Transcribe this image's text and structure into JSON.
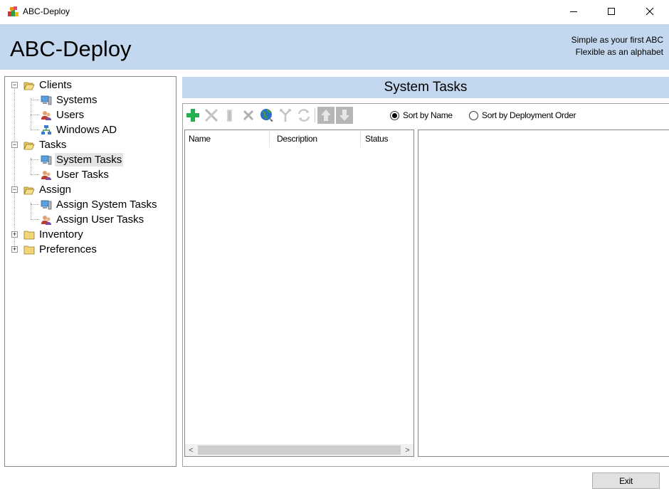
{
  "window": {
    "title": "ABC-Deploy",
    "controls": {
      "minimize": "minimize-icon",
      "maximize": "maximize-icon",
      "close": "close-icon"
    }
  },
  "header": {
    "title": "ABC-Deploy",
    "tagline_line1": "Simple as your first ABC",
    "tagline_line2": "Flexible as an alphabet"
  },
  "colors": {
    "header_band": "#c3d8ee",
    "add_icon": "#22b14c",
    "selection": "#e5e5e5"
  },
  "tree": {
    "clients": {
      "label": "Clients",
      "expanded": true,
      "icon": "folder-open-icon"
    },
    "systems": {
      "label": "Systems",
      "icon": "computer-icon"
    },
    "users": {
      "label": "Users",
      "icon": "users-icon"
    },
    "windows_ad": {
      "label": "Windows AD",
      "icon": "network-icon"
    },
    "tasks": {
      "label": "Tasks",
      "expanded": true,
      "icon": "folder-open-icon"
    },
    "system_tasks": {
      "label": "System Tasks",
      "icon": "computer-icon",
      "selected": true
    },
    "user_tasks": {
      "label": "User Tasks",
      "icon": "users-icon"
    },
    "assign": {
      "label": "Assign",
      "expanded": true,
      "icon": "folder-open-icon"
    },
    "assign_system_tasks": {
      "label": "Assign System Tasks",
      "icon": "computer-icon"
    },
    "assign_user_tasks": {
      "label": "Assign User Tasks",
      "icon": "users-icon"
    },
    "inventory": {
      "label": "Inventory",
      "expanded": false,
      "icon": "folder-closed-icon"
    },
    "preferences": {
      "label": "Preferences",
      "expanded": false,
      "icon": "folder-closed-icon"
    }
  },
  "main": {
    "section_title": "System Tasks",
    "toolbar": [
      "add-icon",
      "tools-icon",
      "column-icon",
      "delete-icon",
      "globe-icon",
      "branch-icon",
      "refresh-icon",
      "move-up-icon",
      "move-down-icon"
    ],
    "sort": {
      "by_name": {
        "label": "Sort by Name",
        "selected": true
      },
      "by_order": {
        "label": "Sort by Deployment Order",
        "selected": false
      }
    },
    "columns": [
      "Name",
      "Description",
      "Status"
    ],
    "rows": []
  },
  "footer": {
    "exit_label": "Exit"
  }
}
